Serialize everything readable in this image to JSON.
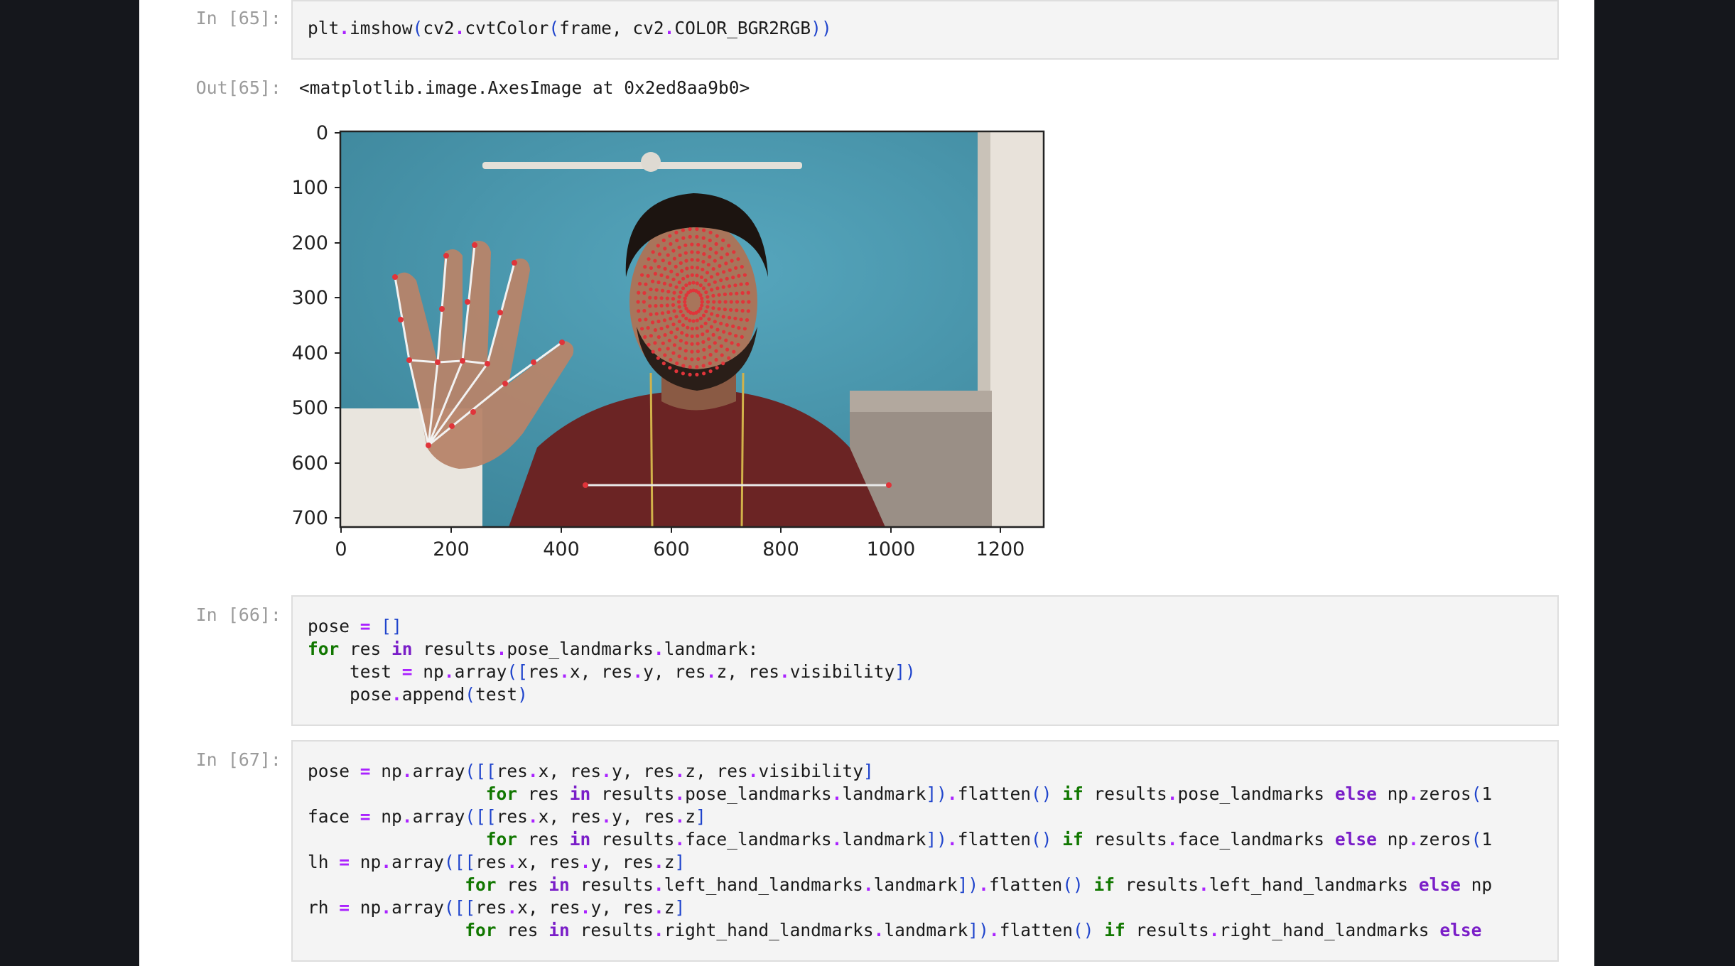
{
  "cells": [
    {
      "in_prompt": "In [65]:",
      "code": "plt.imshow(cv2.cvtColor(frame, cv2.COLOR_BGR2RGB))",
      "out_prompt": "Out[65]:",
      "output_text": "<matplotlib.image.AxesImage at 0x2ed8aa9b0>"
    },
    {
      "in_prompt": "In [66]:",
      "code": "pose = []\nfor res in results.pose_landmarks.landmark:\n    test = np.array([res.x, res.y, res.z, res.visibility])\n    pose.append(test)"
    },
    {
      "in_prompt": "In [67]:",
      "code": "pose = np.array([[res.x, res.y, res.z, res.visibility]\n                 for res in results.pose_landmarks.landmark]).flatten() if results.pose_landmarks else np.zeros(1\nface = np.array([[res.x, res.y, res.z]\n                 for res in results.face_landmarks.landmark]).flatten() if results.face_landmarks else np.zeros(1\nlh = np.array([[res.x, res.y, res.z]\n               for res in results.left_hand_landmarks.landmark]).flatten() if results.left_hand_landmarks else np\nrh = np.array([[res.x, res.y, res.z]\n               for res in results.right_hand_landmarks.landmark]).flatten() if results.right_hand_landmarks else"
    }
  ],
  "chart_data": {
    "type": "image",
    "x_ticks": [
      "0",
      "200",
      "400",
      "600",
      "800",
      "1000",
      "1200"
    ],
    "y_ticks": [
      "0",
      "100",
      "200",
      "300",
      "400",
      "500",
      "600",
      "700"
    ],
    "xlim": [
      0,
      1280
    ],
    "ylim": [
      720,
      0
    ]
  },
  "colors": {
    "background": "#15171c",
    "wall": "#4a9ab0",
    "shirt": "#6b2424",
    "landmark": "#e0343a",
    "keyword": "#117700",
    "operator": "#aa22ff"
  }
}
